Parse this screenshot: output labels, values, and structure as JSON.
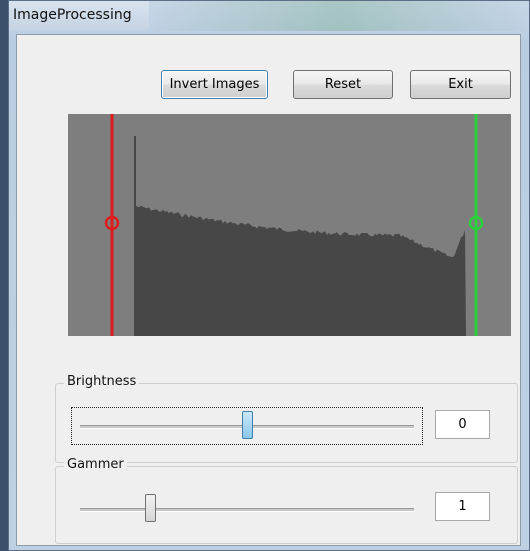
{
  "window": {
    "title": "ImageProcessing"
  },
  "toolbar": {
    "invert_label": "Invert Images",
    "reset_label": "Reset",
    "exit_label": "Exit"
  },
  "histogram": {
    "background_color": "#7e7e7e",
    "fill_color": "#474747",
    "low_marker_color": "#e01b1b",
    "high_marker_color": "#2ad03a",
    "low_marker_level": 0.1,
    "high_marker_level": 0.92
  },
  "brightness": {
    "label": "Brightness",
    "value": "0",
    "slider_level": 0.5
  },
  "gamma": {
    "label": "Gammer",
    "value": "1",
    "slider_level": 0.2
  }
}
